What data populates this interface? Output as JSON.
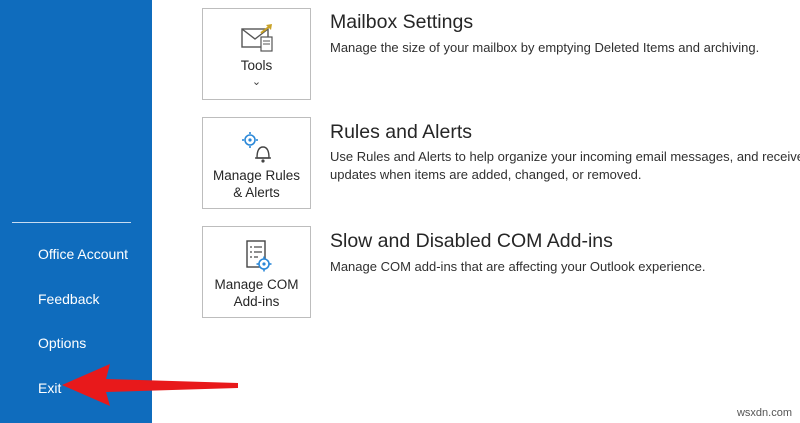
{
  "sidebar": {
    "items": [
      {
        "label": "Office Account"
      },
      {
        "label": "Feedback"
      },
      {
        "label": "Options"
      },
      {
        "label": "Exit"
      }
    ],
    "color": "#0f6cbd"
  },
  "sections": [
    {
      "card_label": "Tools",
      "card_icon": "mailbox-envelope-icon",
      "has_dropdown": true,
      "title": "Mailbox Settings",
      "description": "Manage the size of your mailbox by emptying Deleted Items and archiving."
    },
    {
      "card_label": "Manage Rules\n& Alerts",
      "card_icon": "rules-alerts-icon",
      "title": "Rules and Alerts",
      "description_line1": "Use Rules and Alerts to help organize your incoming email messages, and receive",
      "description_line2": "updates when items are added, changed, or removed."
    },
    {
      "card_label": "Manage COM\nAdd-ins",
      "card_icon": "com-addins-icon",
      "title": "Slow and Disabled COM Add-ins",
      "description": "Manage COM add-ins that are affecting your Outlook experience."
    }
  ],
  "annotation": {
    "arrow_color": "#e8191b",
    "arrow_icon": "red-pointer-arrow-icon"
  },
  "watermark": "wsxdn.com"
}
